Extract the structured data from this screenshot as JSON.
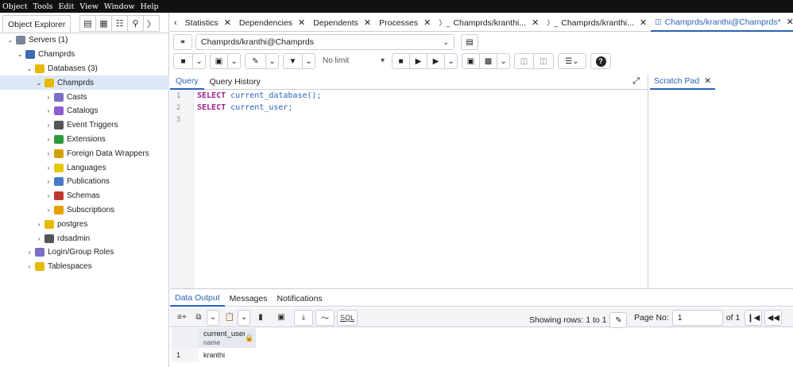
{
  "menu": [
    "Object",
    "Tools",
    "Edit",
    "View",
    "Window",
    "Help"
  ],
  "left_panel": {
    "tab_label": "Object Explorer",
    "tree": [
      {
        "label": "Servers (1)",
        "depth": 0,
        "chev": "v",
        "icon": "servers-icon",
        "color": "#7a8597"
      },
      {
        "label": "Champrds",
        "depth": 1,
        "chev": "v",
        "icon": "server-icon",
        "color": "#3b6bb3"
      },
      {
        "label": "Databases (3)",
        "depth": 2,
        "chev": "v",
        "icon": "databases-icon",
        "color": "#e6b800"
      },
      {
        "label": "Champrds",
        "depth": 3,
        "chev": "v",
        "icon": "database-icon",
        "color": "#e6b800",
        "selected": true
      },
      {
        "label": "Casts",
        "depth": 4,
        "chev": ">",
        "icon": "casts-icon",
        "color": "#7a6fc6"
      },
      {
        "label": "Catalogs",
        "depth": 4,
        "chev": ">",
        "icon": "catalogs-icon",
        "color": "#8e5bd0"
      },
      {
        "label": "Event Triggers",
        "depth": 4,
        "chev": ">",
        "icon": "event-triggers-icon",
        "color": "#555"
      },
      {
        "label": "Extensions",
        "depth": 4,
        "chev": ">",
        "icon": "extensions-icon",
        "color": "#2e9a3e"
      },
      {
        "label": "Foreign Data Wrappers",
        "depth": 4,
        "chev": ">",
        "icon": "foreign-data-wrappers-icon",
        "color": "#d4a000"
      },
      {
        "label": "Languages",
        "depth": 4,
        "chev": ">",
        "icon": "languages-icon",
        "color": "#e6c800"
      },
      {
        "label": "Publications",
        "depth": 4,
        "chev": ">",
        "icon": "publications-icon",
        "color": "#4a7bc8"
      },
      {
        "label": "Schemas",
        "depth": 4,
        "chev": ">",
        "icon": "schemas-icon",
        "color": "#c0392b"
      },
      {
        "label": "Subscriptions",
        "depth": 4,
        "chev": ">",
        "icon": "subscriptions-icon",
        "color": "#e6a000"
      },
      {
        "label": "postgres",
        "depth": 3,
        "chev": ">",
        "icon": "database-icon",
        "color": "#e6b800"
      },
      {
        "label": "rdsadmin",
        "depth": 3,
        "chev": ">",
        "icon": "database-icon",
        "color": "#555"
      },
      {
        "label": "Login/Group Roles",
        "depth": 2,
        "chev": ">",
        "icon": "roles-icon",
        "color": "#7a6fc6"
      },
      {
        "label": "Tablespaces",
        "depth": 2,
        "chev": ">",
        "icon": "tablespaces-icon",
        "color": "#e6b800"
      }
    ]
  },
  "tabs": [
    {
      "label": "Statistics"
    },
    {
      "label": "Dependencies"
    },
    {
      "label": "Dependents"
    },
    {
      "label": "Processes"
    },
    {
      "label": "Champrds/kranthi...",
      "icon": "terminal-icon"
    },
    {
      "label": "Champrds/kranthi...",
      "icon": "terminal-icon"
    },
    {
      "label": "Champrds/kranthi@Champrds*",
      "icon": "query-tool-icon",
      "active": true
    }
  ],
  "connection": {
    "value": "Champrds/kranthi@Champrds"
  },
  "toolbar": {
    "limit_label": "No limit"
  },
  "query_tabs": {
    "query": "Query",
    "history": "Query History",
    "scratch": "Scratch Pad"
  },
  "editor": {
    "line_numbers": [
      "1",
      "2",
      "3"
    ],
    "lines": [
      {
        "kw": "SELECT ",
        "rest": "current_database();"
      },
      {
        "kw": "SELECT ",
        "rest": "current_user;"
      },
      {
        "kw": "",
        "rest": ""
      }
    ]
  },
  "bottom": {
    "tabs": [
      "Data Output",
      "Messages",
      "Notifications"
    ],
    "showing_rows": "Showing rows: 1 to 1",
    "page_no_label": "Page No:",
    "page_no": "1",
    "of_pages": "of 1",
    "sql_label": "SQL",
    "column": {
      "name": "current_user",
      "type": "name"
    },
    "rows": [
      {
        "n": "1",
        "value": "kranthi"
      }
    ]
  }
}
